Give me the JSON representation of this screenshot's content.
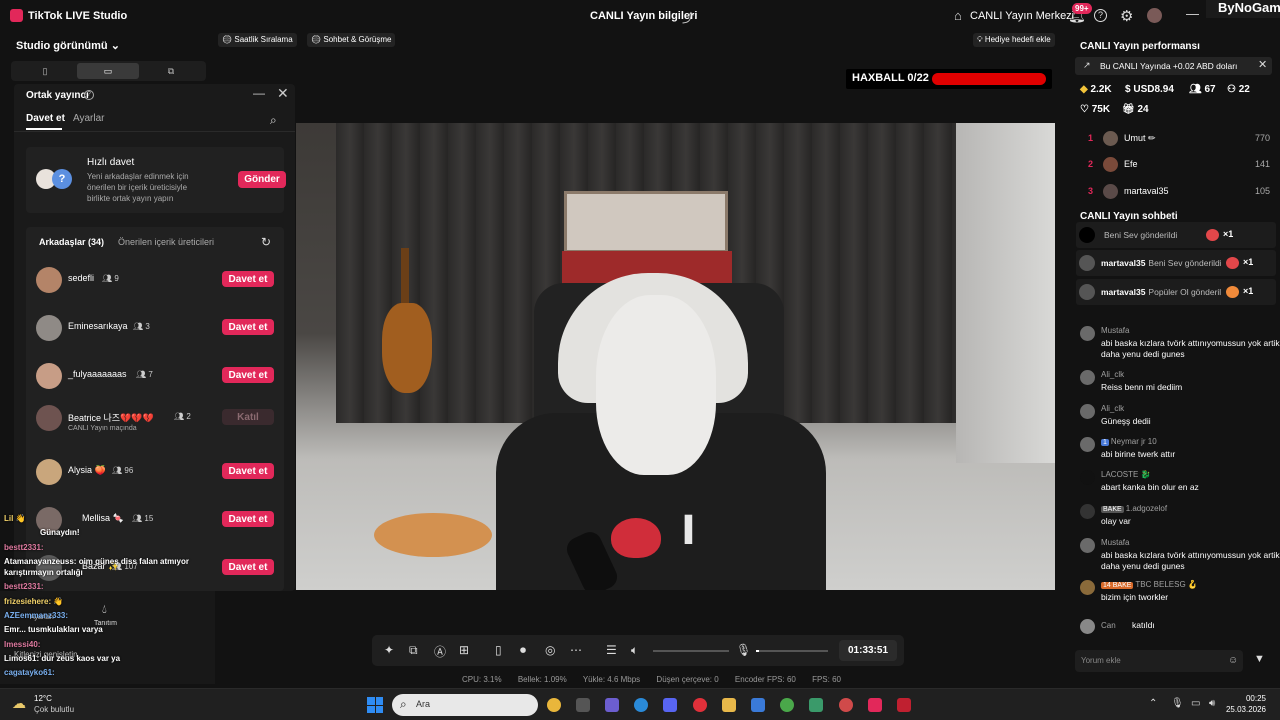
{
  "app": {
    "title": "TikTok LIVE Studio",
    "center_title": "CANLI Yayın bilgileri",
    "live_center": "CANLI Yayın Merkezi",
    "notif_badge": "99+",
    "brand": "ByNoGame"
  },
  "left": {
    "studio_view": "Studio görünümü",
    "partner": {
      "title": "Ortak yayıncı",
      "tabs": [
        "Davet et",
        "Ayarlar"
      ],
      "quick": {
        "title": "Hızlı davet",
        "desc": "Yeni arkadaşlar edinmek için önerilen bir içerik üreticisiyle birlikte ortak yayın yapın",
        "button": "Gönder"
      },
      "friends_tab": "Arkadaşlar (34)",
      "suggested_tab": "Önerilen içerik üreticileri",
      "friends": [
        {
          "name": "sedefli",
          "count": "9",
          "button": "Davet et",
          "sub": ""
        },
        {
          "name": "Eminesarıkaya",
          "count": "3",
          "button": "Davet et",
          "sub": ""
        },
        {
          "name": "_fulyaaaaaaas",
          "count": "7",
          "button": "Davet et",
          "sub": ""
        },
        {
          "name": "Beatrice 나즈💔💔💔",
          "count": "2",
          "button": "Katıl",
          "sub": "CANLI Yayın maçında"
        },
        {
          "name": "Alysia 🍑",
          "count": "96",
          "button": "Davet et",
          "sub": ""
        },
        {
          "name": "Mellisa 🍬",
          "count": "15",
          "button": "Davet et",
          "sub": ""
        },
        {
          "name": "Bazar ✨",
          "count": "107",
          "button": "Davet et",
          "sub": ""
        }
      ]
    },
    "overlay_chat": [
      "Lil 👋",
      "Günaydın!",
      "bestt2331:",
      "Atamanayanzeuss: oim güneş diss falan atmıyor",
      "karıştırmayın ortalığı",
      "bestt2331:",
      "frizesiehere: 👋",
      "AZEemmanz333:",
      "Emr... tusmkulakları varya",
      "Imessi40:",
      "Limos61: dur zeus kaos var ya",
      "cagatayko61: "
    ],
    "widget": {
      "ayarlar": "Ayarları",
      "tanitim": "Tanıtım",
      "kitle": "Kitlenizi genişletin"
    }
  },
  "top_pills": [
    "Saatlik Sıralama",
    "Sohbet & Görüşme"
  ],
  "gift_goal": "Hediye hedefi ekle",
  "haxball": {
    "label": "HAXBALL 0/22",
    "progress": 1.0
  },
  "controls": {
    "timer": "01:33:51",
    "volume_level": 0,
    "mic_level": 0.04
  },
  "stats": {
    "cpu": "CPU: 3.1%",
    "memory": "Bellek: 1.09%",
    "upload": "Yükle: 4.6 Mbps",
    "dropped": "Düşen çerçeve: 0",
    "encoder_fps": "Encoder FPS: 60",
    "fps": "FPS: 60"
  },
  "right": {
    "perf_title": "CANLI Yayın performansı",
    "perf_banner": "Bu CANLI Yayında +0.02 ABD doları",
    "stats": {
      "diamonds": "2.2K",
      "usd": "USD8.94",
      "viewers": "67",
      "followers": "22",
      "likes": "75K",
      "gifts": "24"
    },
    "ranking": [
      {
        "rank": "1",
        "name": "Umut ✏",
        "value": "770"
      },
      {
        "rank": "2",
        "name": "Efe",
        "value": "141"
      },
      {
        "rank": "3",
        "name": "martaval35",
        "value": "105"
      }
    ],
    "chat_title": "CANLI Yayın sohbeti",
    "gifts": [
      {
        "user": "",
        "text": "Beni Sev gönderildi",
        "x": "×1"
      },
      {
        "user": "martaval35",
        "text": "Beni Sev gönderildi",
        "x": "×1"
      },
      {
        "user": "martaval35",
        "text": "Popüler Ol gönderildi",
        "x": "×1"
      }
    ],
    "messages": [
      {
        "user": "Mustafa",
        "badge": "",
        "text": "abi baska kızlara tvörk attınıyomussun yok artik daha yenu dedi gunes"
      },
      {
        "user": "Ali_clk",
        "badge": "",
        "text": "Reiss benn mi dediim"
      },
      {
        "user": "Ali_clk",
        "badge": "",
        "text": "Güneşş dedii"
      },
      {
        "user": "Neymar jr 10",
        "badge": "1",
        "text": "abi birine twerk attır"
      },
      {
        "user": "LACOSTE 🐉",
        "badge": "",
        "text": "abart kanka bin olur en az"
      },
      {
        "user": "1.adgozelof",
        "badge": "BAKE",
        "text": "olay var"
      },
      {
        "user": "Mustafa",
        "badge": "",
        "text": "abi baska kızlara tvörk attınıyomussun yok artik daha yenu dedi gunes"
      },
      {
        "user": "TBC BELESG 🪝",
        "badge": "14 BAKE",
        "text": "bizim için tworkler"
      },
      {
        "user": "Can",
        "badge": "",
        "text": "katıldı"
      }
    ],
    "comment_placeholder": "Yorum ekle"
  },
  "taskbar": {
    "temp": "12°C",
    "weather": "Çok bulutlu",
    "search": "Ara",
    "time": "00:25",
    "date": "25.03.2026"
  }
}
